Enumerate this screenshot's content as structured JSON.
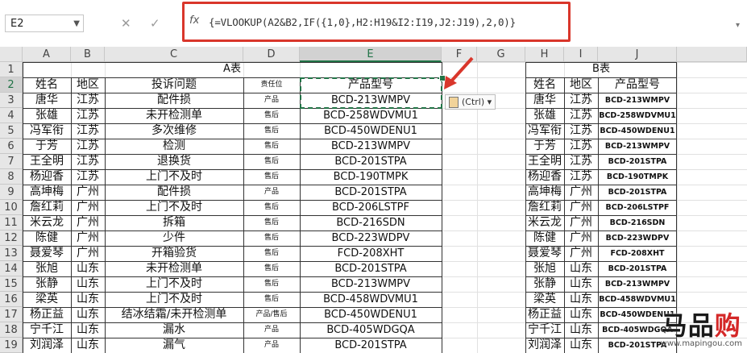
{
  "formula_bar": {
    "name_box": "E2",
    "cancel_icon": "✕",
    "enter_icon": "✓",
    "fx_icon": "fx",
    "formula": "{=VLOOKUP(A2&B2,IF({1,0},H2:H19&I2:I19,J2:J19),2,0)}"
  },
  "columns": [
    "A",
    "B",
    "C",
    "D",
    "E",
    "F",
    "G",
    "H",
    "I",
    "J"
  ],
  "selected_column": "E",
  "selected_row": 2,
  "table_a": {
    "title": "A表",
    "headers": [
      "姓名",
      "地区",
      "投诉问题",
      "责任位",
      "产品型号"
    ],
    "rows": [
      [
        "唐华",
        "江苏",
        "配件损",
        "产品",
        "BCD-213WMPV"
      ],
      [
        "张雄",
        "江苏",
        "未开检测单",
        "售后",
        "BCD-258WDVMU1"
      ],
      [
        "冯军衔",
        "江苏",
        "多次维修",
        "售后",
        "BCD-450WDENU1"
      ],
      [
        "于芳",
        "江苏",
        "检测",
        "售后",
        "BCD-213WMPV"
      ],
      [
        "王全明",
        "江苏",
        "退换货",
        "售后",
        "BCD-201STPA"
      ],
      [
        "杨迎香",
        "江苏",
        "上门不及时",
        "售后",
        "BCD-190TMPK"
      ],
      [
        "高坤梅",
        "广州",
        "配件损",
        "产品",
        "BCD-201STPA"
      ],
      [
        "詹红莉",
        "广州",
        "上门不及时",
        "售后",
        "BCD-206LSTPF"
      ],
      [
        "米云龙",
        "广州",
        "拆箱",
        "售后",
        "BCD-216SDN"
      ],
      [
        "陈健",
        "广州",
        "少件",
        "售后",
        "BCD-223WDPV"
      ],
      [
        "聂爱琴",
        "广州",
        "开箱验货",
        "售后",
        "FCD-208XHT"
      ],
      [
        "张旭",
        "山东",
        "未开检测单",
        "售后",
        "BCD-201STPA"
      ],
      [
        "张静",
        "山东",
        "上门不及时",
        "售后",
        "BCD-213WMPV"
      ],
      [
        "梁英",
        "山东",
        "上门不及时",
        "售后",
        "BCD-458WDVMU1"
      ],
      [
        "杨正益",
        "山东",
        "结冰结霜/未开检测单",
        "产品/售后",
        "BCD-450WDENU1"
      ],
      [
        "宁千江",
        "山东",
        "漏水",
        "产品",
        "BCD-405WDGQA"
      ],
      [
        "刘润泽",
        "山东",
        "漏气",
        "产品",
        "BCD-201STPA"
      ]
    ]
  },
  "table_b": {
    "title": "B表",
    "headers": [
      "姓名",
      "地区",
      "产品型号"
    ],
    "rows": [
      [
        "唐华",
        "江苏",
        "BCD-213WMPV"
      ],
      [
        "张雄",
        "江苏",
        "BCD-258WDVMU1"
      ],
      [
        "冯军衔",
        "江苏",
        "BCD-450WDENU1"
      ],
      [
        "于芳",
        "江苏",
        "BCD-213WMPV"
      ],
      [
        "王全明",
        "江苏",
        "BCD-201STPA"
      ],
      [
        "杨迎香",
        "江苏",
        "BCD-190TMPK"
      ],
      [
        "高坤梅",
        "广州",
        "BCD-201STPA"
      ],
      [
        "詹红莉",
        "广州",
        "BCD-206LSTPF"
      ],
      [
        "米云龙",
        "广州",
        "BCD-216SDN"
      ],
      [
        "陈健",
        "广州",
        "BCD-223WDPV"
      ],
      [
        "聂爱琴",
        "广州",
        "FCD-208XHT"
      ],
      [
        "张旭",
        "山东",
        "BCD-201STPA"
      ],
      [
        "张静",
        "山东",
        "BCD-213WMPV"
      ],
      [
        "梁英",
        "山东",
        "BCD-458WDVMU1"
      ],
      [
        "杨正益",
        "山东",
        "BCD-450WDENU1"
      ],
      [
        "宁千江",
        "山东",
        "BCD-405WDGQA"
      ],
      [
        "刘润泽",
        "山东",
        "BCD-201STPA"
      ]
    ]
  },
  "paste_options": "(Ctrl)",
  "watermark": {
    "main_a": "马",
    "main_b": "品",
    "main_c": "购",
    "url": "www.mapingou.com"
  },
  "colors": {
    "accent": "#217346",
    "highlight": "#d9362b"
  }
}
